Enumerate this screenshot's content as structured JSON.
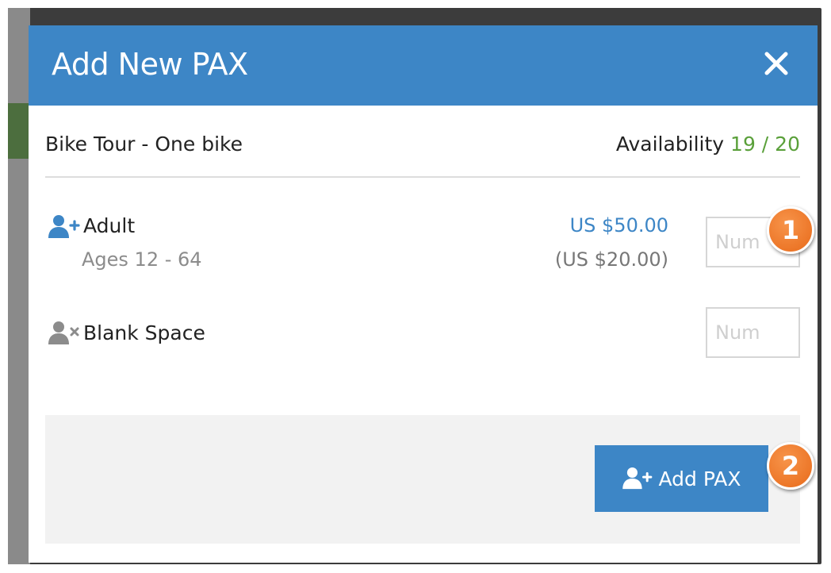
{
  "modal": {
    "title": "Add New PAX",
    "close_icon": "close-icon"
  },
  "tour": {
    "name": "Bike Tour - One bike",
    "availability_label": "Availability",
    "availability_value": "19 / 20"
  },
  "pax_types": [
    {
      "label": "Adult",
      "ages": "Ages 12 - 64",
      "price": "US $50.00",
      "price_secondary": "(US $20.00)",
      "icon": "user-plus-icon",
      "quantity_placeholder": "Num"
    },
    {
      "label": "Blank Space",
      "icon": "user-times-icon",
      "quantity_placeholder": "Num"
    }
  ],
  "footer": {
    "add_button_label": "Add PAX",
    "add_button_icon": "user-plus-icon"
  },
  "callouts": [
    "1",
    "2"
  ],
  "colors": {
    "header": "#3d86c6",
    "availability": "#5aa03a",
    "price": "#3d86c6",
    "callout": "#f0792a"
  }
}
